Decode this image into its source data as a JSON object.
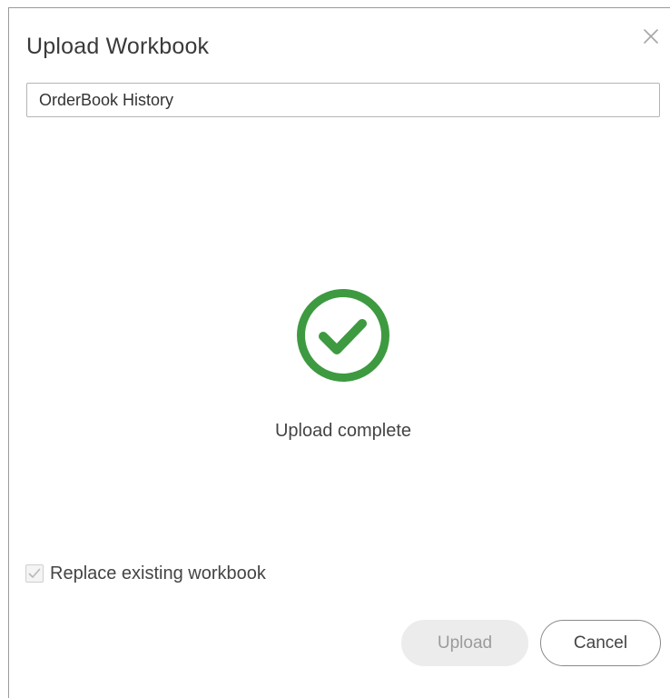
{
  "dialog": {
    "title": "Upload Workbook",
    "close_icon": "close-icon",
    "name_input": {
      "value": "OrderBook History"
    },
    "status": {
      "icon": "check-circle-icon",
      "icon_color": "#3d9a40",
      "text": "Upload complete"
    },
    "replace_option": {
      "label": "Replace existing workbook",
      "checked": true,
      "disabled": true
    },
    "buttons": {
      "upload_label": "Upload",
      "cancel_label": "Cancel"
    }
  }
}
